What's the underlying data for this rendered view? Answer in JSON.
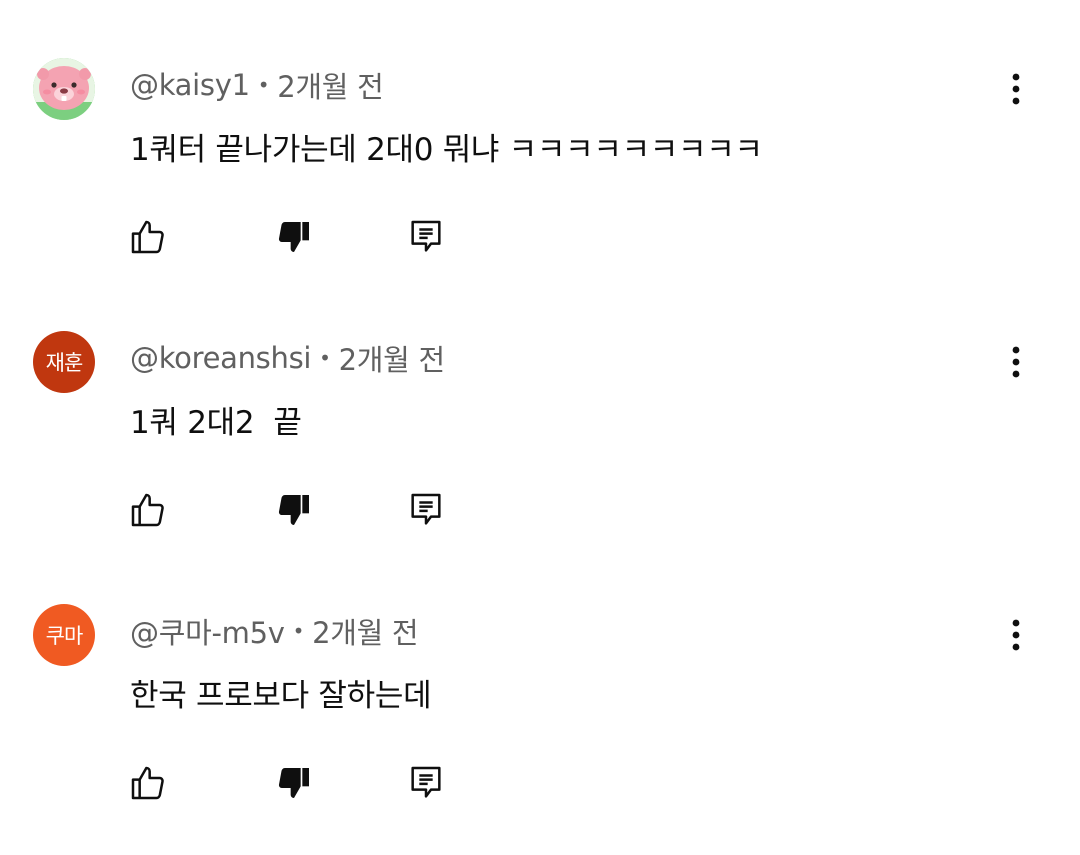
{
  "comments": [
    {
      "author": "@kaisy1",
      "separator": "•",
      "time": "2개월 전",
      "text": "1쿼터 끝나가는데 2대0 뭐냐 ㅋㅋㅋㅋㅋㅋㅋㅋㅋ",
      "avatar": {
        "type": "image",
        "icon": "pink-beaver-character-icon",
        "bg": "#7ccf80",
        "fg": "#f5a9b8"
      }
    },
    {
      "author": "@koreanshsi",
      "separator": "•",
      "time": "2개월 전",
      "text": "1쿼 2대2  끝",
      "avatar": {
        "type": "letters",
        "label": "재훈",
        "bg": "#c0370f"
      }
    },
    {
      "author": "@쿠마-m5v",
      "separator": "•",
      "time": "2개월 전",
      "text": "한국 프로보다 잘하는데",
      "avatar": {
        "type": "letters",
        "label": "쿠마",
        "bg": "#f05a22"
      }
    }
  ],
  "icons": {
    "like": "thumbs-up-outline-icon",
    "dislike": "thumbs-down-filled-icon",
    "reply": "reply-comment-icon",
    "more": "vertical-ellipsis-icon"
  },
  "colors": {
    "meta_text": "#606060",
    "body_text": "#0f0f0f",
    "icon": "#0f0f0f"
  }
}
